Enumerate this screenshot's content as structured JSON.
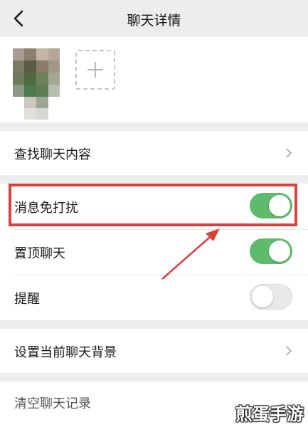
{
  "header": {
    "title": "聊天详情",
    "back_icon": "chevron-left-icon"
  },
  "members": {
    "add_icon": "plus-icon"
  },
  "menu": {
    "search_history": "查找聊天内容",
    "mute_notifications": {
      "label": "消息免打扰",
      "enabled": true
    },
    "sticky_on_top": {
      "label": "置顶聊天",
      "enabled": true
    },
    "reminder": {
      "label": "提醒",
      "enabled": false
    },
    "set_background": "设置当前聊天背景",
    "clear_history": "清空聊天记录"
  },
  "annotation": {
    "highlight_color": "#d9413d"
  },
  "colors": {
    "toggle_on": "#5fbb6b",
    "toggle_off": "#e9e9e9",
    "background": "#ededed"
  },
  "watermark": "煎蛋手游"
}
